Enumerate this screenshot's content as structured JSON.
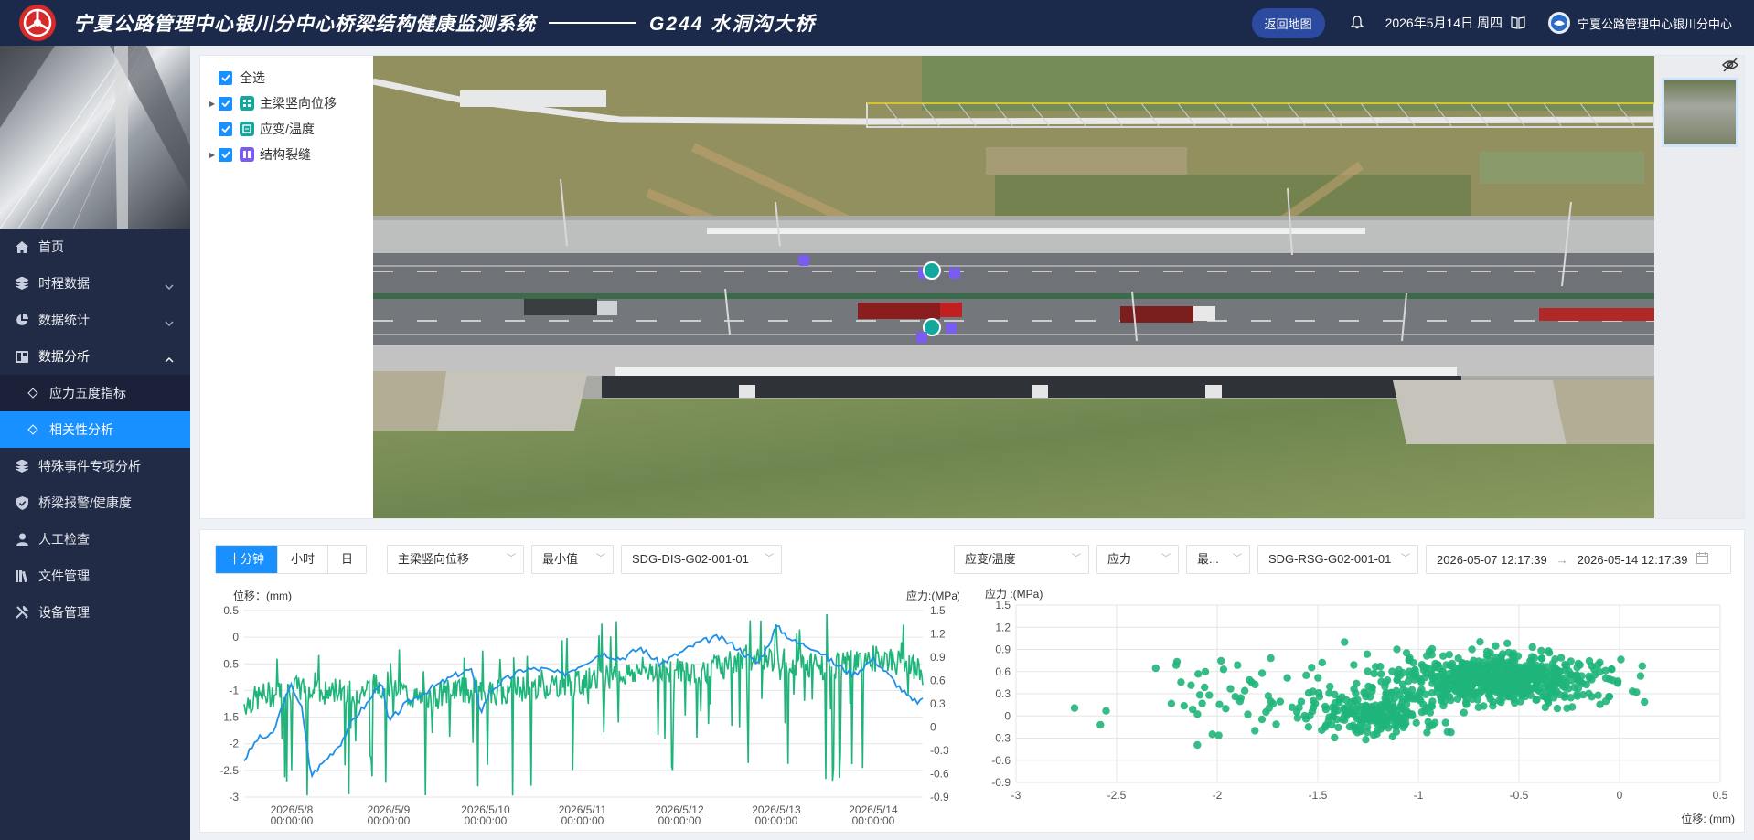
{
  "header": {
    "title": "宁夏公路管理中心银川分中心桥梁结构健康监测系统",
    "bridge": "G244  水洞沟大桥",
    "back_button": "返回地图",
    "date": "2026年5月14日 周四",
    "user": "宁夏公路管理中心银川分中心",
    "colors": {
      "header_bg": "#1b2a4a",
      "accent": "#1890ff",
      "logo": "#d62b2b"
    }
  },
  "sidebar": {
    "items": [
      {
        "label": "首页",
        "icon": "home-icon"
      },
      {
        "label": "时程数据",
        "icon": "layers-icon",
        "expandable": true
      },
      {
        "label": "数据统计",
        "icon": "pie-chart-icon",
        "expandable": true
      },
      {
        "label": "数据分析",
        "icon": "dashboard-icon",
        "expanded": true,
        "children": [
          {
            "label": "应力五度指标",
            "active": false
          },
          {
            "label": "相关性分析",
            "active": true
          }
        ]
      },
      {
        "label": "特殊事件专项分析",
        "icon": "layers-icon"
      },
      {
        "label": "桥梁报警/健康度",
        "icon": "shield-icon"
      },
      {
        "label": "人工检查",
        "icon": "person-icon"
      },
      {
        "label": "文件管理",
        "icon": "books-icon"
      },
      {
        "label": "设备管理",
        "icon": "tools-icon"
      }
    ]
  },
  "tree": {
    "select_all": "全选",
    "nodes": [
      {
        "label": "主梁竖向位移",
        "expandable": true,
        "icon_color": "#13a89e"
      },
      {
        "label": "应变/温度",
        "expandable": false,
        "icon_color": "#13a89e"
      },
      {
        "label": "结构裂缝",
        "expandable": true,
        "icon_color": "#7b5cf0"
      }
    ]
  },
  "controls": {
    "granularity": [
      "十分钟",
      "小时",
      "日"
    ],
    "granularity_selected": "十分钟",
    "left_type": "主梁竖向位移",
    "left_stat": "最小值",
    "left_sensor": "SDG-DIS-G02-001-01",
    "right_type": "应变/温度",
    "right_metric": "应力",
    "right_stat": "最...",
    "right_sensor": "SDG-RSG-G02-001-01",
    "start": "2026-05-07 12:17:39",
    "range_sep": "→",
    "end": "2026-05-14 12:17:39"
  },
  "chart_data": [
    {
      "type": "line",
      "ylabel_left": "位移：(mm)",
      "ylabel_right": "应力:(MPa)",
      "ylim_left": [
        -3,
        0.5
      ],
      "yticks_left": [
        "0.5",
        "0",
        "-0.5",
        "-1",
        "-1.5",
        "-2",
        "-2.5",
        "-3"
      ],
      "ylim_right": [
        -0.9,
        1.5
      ],
      "yticks_right": [
        "1.5",
        "1.2",
        "0.9",
        "0.6",
        "0.3",
        "0",
        "-0.3",
        "-0.6",
        "-0.9"
      ],
      "x_ticks": [
        {
          "date": "2026/5/8",
          "time": "00:00:00"
        },
        {
          "date": "2026/5/9",
          "time": "00:00:00"
        },
        {
          "date": "2026/5/10",
          "time": "00:00:00"
        },
        {
          "date": "2026/5/11",
          "time": "00:00:00"
        },
        {
          "date": "2026/5/12",
          "time": "00:00:00"
        },
        {
          "date": "2026/5/13",
          "time": "00:00:00"
        },
        {
          "date": "2026/5/14",
          "time": "00:00:00"
        }
      ],
      "x_range_days": [
        -0.49,
        6.51
      ],
      "series": [
        {
          "axis": "left",
          "color": "#1e90e8",
          "x": [
            -0.49,
            -0.35,
            -0.2,
            -0.1,
            0,
            0.1,
            0.2,
            0.35,
            0.5,
            0.65,
            0.8,
            0.92,
            1.0,
            1.15,
            1.3,
            1.5,
            1.7,
            1.85,
            1.95,
            2.05,
            2.2,
            2.4,
            2.6,
            2.8,
            3.0,
            3.2,
            3.4,
            3.6,
            3.8,
            4.0,
            4.2,
            4.4,
            4.6,
            4.8,
            4.9,
            5.0,
            5.2,
            5.4,
            5.6,
            5.8,
            6.0,
            6.2,
            6.3,
            6.4,
            6.51
          ],
          "values": [
            -2.3,
            -1.9,
            -1.85,
            -1.3,
            -0.9,
            -1.3,
            -2.6,
            -2.3,
            -2.0,
            -1.5,
            -1.2,
            -0.8,
            -1.6,
            -1.3,
            -1.1,
            -0.9,
            -0.7,
            -0.6,
            -1.4,
            -1.0,
            -0.8,
            -0.6,
            -0.6,
            -0.7,
            -0.5,
            -0.3,
            -0.4,
            -0.2,
            -0.5,
            -0.3,
            -0.1,
            0.0,
            -0.2,
            -0.5,
            -0.2,
            0.2,
            -0.1,
            -0.2,
            -0.5,
            -0.7,
            -0.4,
            -0.8,
            -1.0,
            -1.2,
            -1.2
          ]
        },
        {
          "axis": "right",
          "color": "#1fb57a",
          "noisy": true,
          "x": [
            -0.49,
            -0.3,
            -0.1,
            0.1,
            0.3,
            0.5,
            0.7,
            0.9,
            1.1,
            1.3,
            1.5,
            1.7,
            1.9,
            2.1,
            2.3,
            2.5,
            2.7,
            2.9,
            3.1,
            3.3,
            3.5,
            3.7,
            3.9,
            4.1,
            4.3,
            4.5,
            4.7,
            4.9,
            5.1,
            5.3,
            5.5,
            5.7,
            5.9,
            6.1,
            6.3,
            6.51
          ],
          "values": [
            0.3,
            0.4,
            0.45,
            0.5,
            0.4,
            0.5,
            0.45,
            0.55,
            0.5,
            0.35,
            0.4,
            0.5,
            0.45,
            0.45,
            0.5,
            0.5,
            0.55,
            0.55,
            0.6,
            0.65,
            0.7,
            0.75,
            0.75,
            0.7,
            0.75,
            0.8,
            0.85,
            0.9,
            0.85,
            0.8,
            0.75,
            0.8,
            0.85,
            0.9,
            0.8,
            0.7
          ]
        }
      ]
    },
    {
      "type": "scatter",
      "ylabel": "应力 :(MPa)",
      "xlabel": "位移: (mm)",
      "xlim": [
        -3,
        0.5
      ],
      "xticks": [
        "-3",
        "-2.5",
        "-2",
        "-1.5",
        "-1",
        "-0.5",
        "0",
        "0.5"
      ],
      "ylim": [
        -0.9,
        1.5
      ],
      "yticks": [
        "1.5",
        "1.2",
        "0.9",
        "0.6",
        "0.3",
        "0",
        "-0.3",
        "-0.6",
        "-0.9"
      ],
      "color": "#1fb57a",
      "clusters": [
        {
          "cx": -0.6,
          "cy": 0.5,
          "sx": 0.45,
          "sy": 0.28,
          "n": 650
        },
        {
          "cx": -1.2,
          "cy": 0.05,
          "sx": 0.25,
          "sy": 0.25,
          "n": 200
        },
        {
          "cx": -1.8,
          "cy": 0.2,
          "sx": 0.55,
          "sy": 0.45,
          "n": 70
        }
      ]
    }
  ]
}
